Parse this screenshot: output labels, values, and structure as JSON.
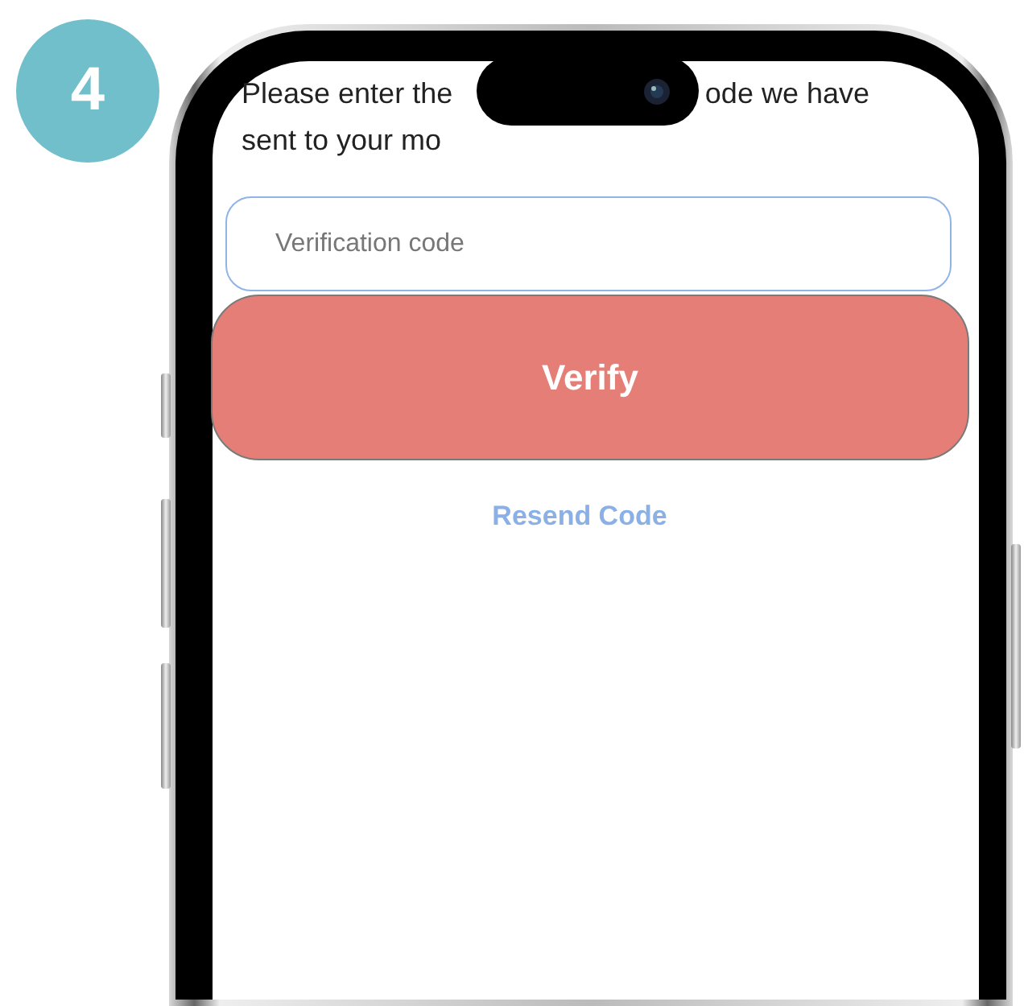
{
  "step_badge": "4",
  "instruction": {
    "lines": [
      [
        "Please enter the",
        "ode we have"
      ],
      [
        "sent to your mo"
      ]
    ]
  },
  "code_field": {
    "placeholder": "Verification code"
  },
  "verify_button": {
    "label": "Verify"
  },
  "resend_link": {
    "label": "Resend Code"
  }
}
